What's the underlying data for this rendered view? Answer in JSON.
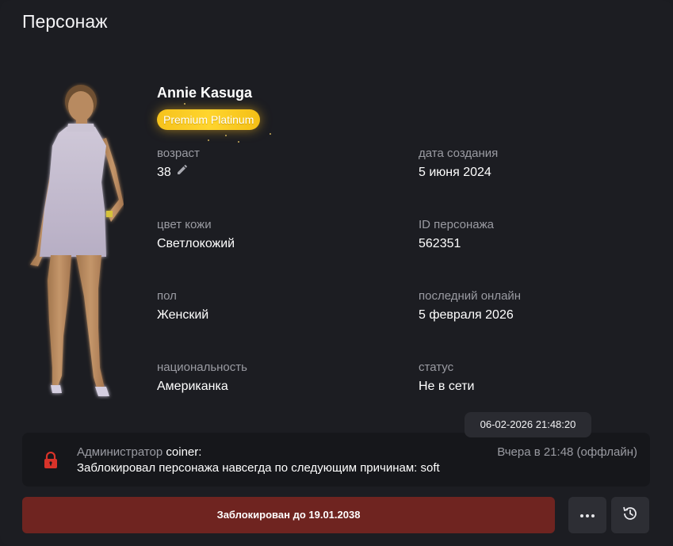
{
  "header": {
    "title": "Персонаж"
  },
  "character": {
    "name": "Annie Kasuga",
    "badge": "Premium Platinum"
  },
  "fields": {
    "age": {
      "label": "возраст",
      "value": "38"
    },
    "created": {
      "label": "дата создания",
      "value": "5 июня 2024"
    },
    "skin": {
      "label": "цвет кожи",
      "value": "Светлокожий"
    },
    "id": {
      "label": "ID персонажа",
      "value": "562351"
    },
    "gender": {
      "label": "пол",
      "value": "Женский"
    },
    "last_online": {
      "label": "последний онлайн",
      "value": "5 февраля 2026"
    },
    "nationality": {
      "label": "национальность",
      "value": "Американка"
    },
    "status": {
      "label": "статус",
      "value": "Не в сети"
    }
  },
  "tooltip": {
    "text": "06-02-2026 21:48:20"
  },
  "log": {
    "role": "Администратор",
    "admin": "coiner:",
    "time": "Вчера в 21:48 (оффлайн)",
    "text": "Заблокировал персонажа навсегда по следующим причинам: soft",
    "icon": "lock-icon"
  },
  "actions": {
    "ban_label": "Заблокирован до 19.01.2038",
    "more_icon": "more-icon",
    "history_icon": "history-icon"
  },
  "colors": {
    "background": "#1c1d22",
    "badge": "#ffd52e",
    "ban_button": "#6f2420",
    "lock": "#d8332a"
  }
}
